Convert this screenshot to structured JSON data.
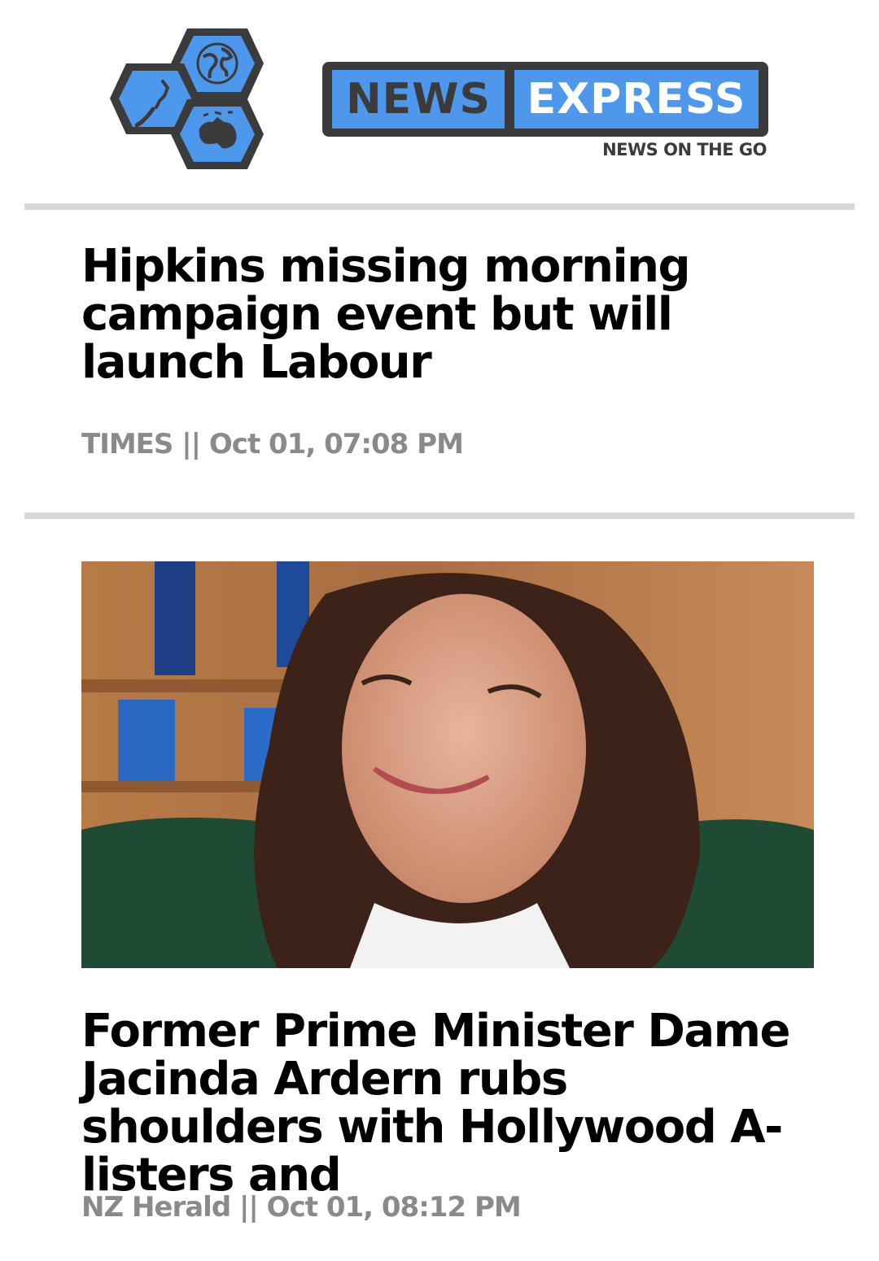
{
  "header": {
    "logo_part1": "NEWS",
    "logo_part2": "EXPRESS",
    "tagline": "NEWS ON THE GO",
    "colors": {
      "brand_blue": "#4d98ec",
      "brand_dark": "#3b3b3b"
    }
  },
  "articles": [
    {
      "headline": "Hipkins missing morning campaign event but will launch Labour",
      "meta": "TIMES || Oct 01, 07:08 PM"
    },
    {
      "image_icon": "portrait-photo",
      "headline": "Former Prime Minister Dame Jacinda Ardern rubs shoulders with Hollywood A-listers and",
      "meta": "NZ Herald || Oct 01, 08:12 PM"
    }
  ]
}
